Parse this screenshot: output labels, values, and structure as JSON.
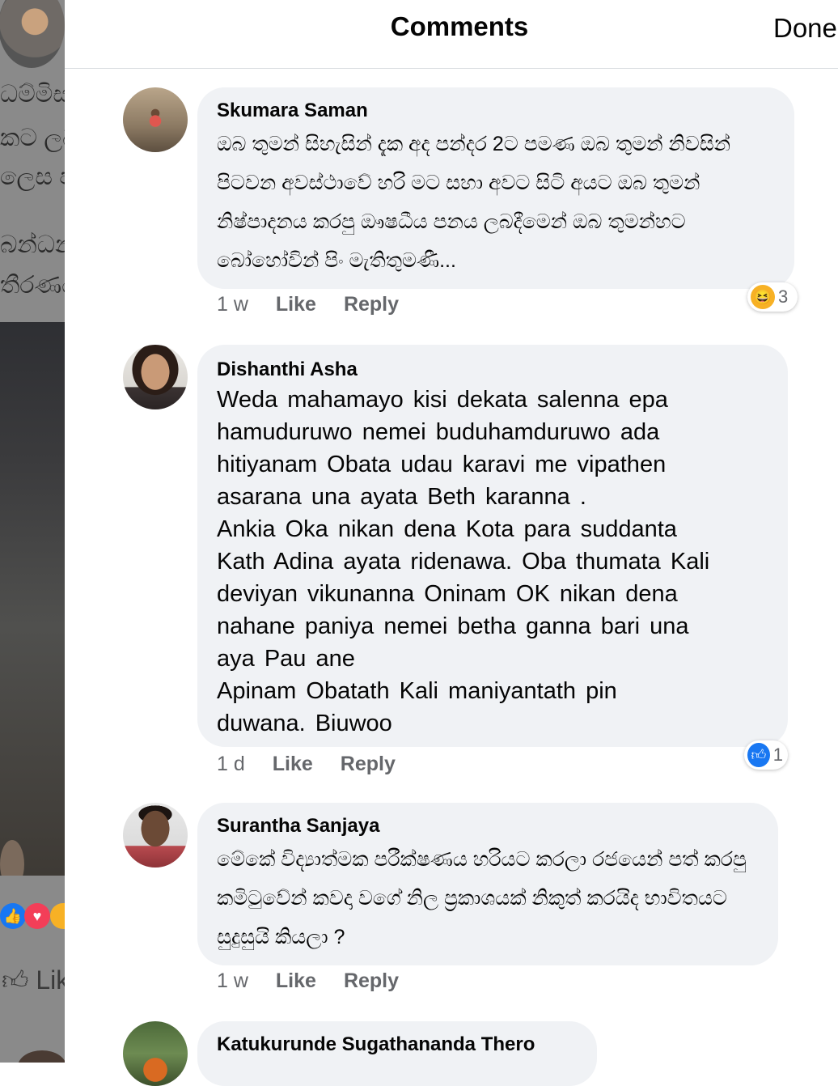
{
  "background": {
    "text_lines": [
      "ධම්මිස",
      "කට ලබ",
      "ලෙස ප",
      "බන්ධන",
      "තීරණය"
    ],
    "like_label": "Lik"
  },
  "modal": {
    "title": "Comments",
    "done_label": "Done"
  },
  "comments": [
    {
      "author": "Skumara Saman",
      "text": "ඔබ තුමන් සිහැසින් දැක අද පන්දර 2ට පමණ ඔබ තුමන් නිවසින් පිටවන අවස්ථාවේ හරි මට සහා අවට සිටි අයට ඔබ තුමන් නිෂ්පාදනය කරපු ඖෂධීය පනය ලබදීමෙන් ඔබ තුමන්හට බෝහෝවින් පිං මැතිතුමණී...",
      "time": "1 w",
      "like_label": "Like",
      "reply_label": "Reply",
      "reaction": {
        "icon": "haha-icon",
        "count": "3"
      }
    },
    {
      "author": "Dishanthi Asha",
      "text": "Weda  mahamayo  kisi  dekata  salenna  epa\nhamuduruwo nemei  buduhamduruwo  ada\nhitiyanam  Obata  udau  karavi  me  vipathen\nasarana   una ayata  Beth  karanna  .\nAnkia  Oka  nikan  dena  Kota  para  suddanta\nKath  Adina  ayata  ridenawa. Oba thumata  Kali\ndeviyan  vikunanna  Oninam  OK  nikan  dena\nnahane   paniya  nemei  betha  ganna  bari  una\naya  Pau ane\nApinam  Obatath  Kali maniyantath  pin\nduwana.  Biuwoo",
      "time": "1 d",
      "like_label": "Like",
      "reply_label": "Reply",
      "reaction": {
        "icon": "like-icon",
        "count": "1"
      }
    },
    {
      "author": "Surantha Sanjaya",
      "text": "මේකේ විද්‍යාත්මක පරීක්ෂණය හරියට කරලා රජයෙන් පත් කරපු කමිටුවේන් කවදා වගේ නිල ප්‍රකාශයක් නිකුත් කරයිද භාවිතයට සුදුසුයි කියලා ?",
      "time": "1 w",
      "like_label": "Like",
      "reply_label": "Reply"
    },
    {
      "author": "Katukurunde Sugathananda Thero"
    }
  ],
  "colors": {
    "bubble": "#f0f2f5",
    "meta": "#65676b",
    "like_blue": "#1877f2",
    "haha_yellow": "#f7b125"
  }
}
